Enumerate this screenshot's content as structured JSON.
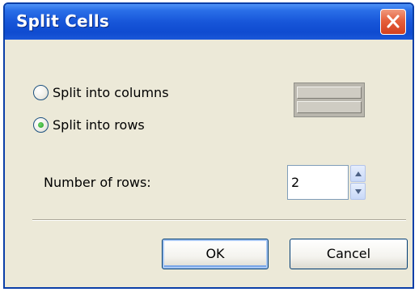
{
  "dialog": {
    "title": "Split Cells",
    "close_label": "close"
  },
  "options": {
    "split_columns_label": "Split into columns",
    "split_rows_label": "Split into rows",
    "selected": "rows"
  },
  "rows": {
    "label": "Number of rows:",
    "value": "2"
  },
  "buttons": {
    "ok_label": "OK",
    "cancel_label": "Cancel"
  },
  "colors": {
    "titlebar": "#0f4bd0",
    "dialog_background": "#ece9d8",
    "close_button": "#e5603c",
    "radio_selected_dot": "#21a121"
  },
  "icons": {
    "close": "close-icon",
    "spin_up": "chevron-up-icon",
    "spin_down": "chevron-down-icon"
  }
}
